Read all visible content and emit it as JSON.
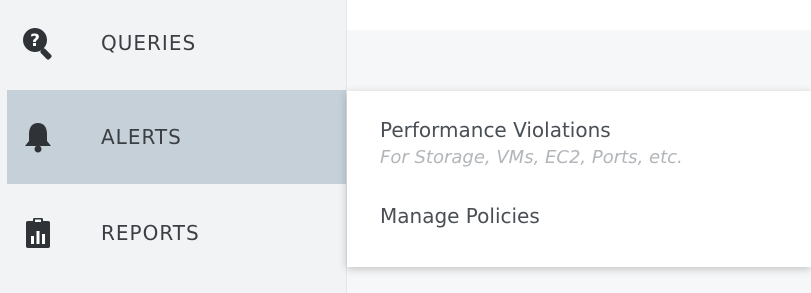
{
  "sidebar": {
    "items": [
      {
        "label": "QUERIES",
        "icon": "question-search-icon",
        "active": false
      },
      {
        "label": "ALERTS",
        "icon": "bell-icon",
        "active": true
      },
      {
        "label": "REPORTS",
        "icon": "clipboard-chart-icon",
        "active": false
      }
    ]
  },
  "flyout": {
    "items": [
      {
        "label": "Performance Violations",
        "sublabel": "For Storage, VMs, EC2, Ports, etc."
      },
      {
        "label": "Manage Policies"
      }
    ]
  },
  "colors": {
    "sidebar_bg": "#f1f3f4",
    "active_item_bg": "#c5d0d9",
    "icon": "#2f3338",
    "text": "#3b3f43",
    "subtext": "#b2b6ba"
  }
}
